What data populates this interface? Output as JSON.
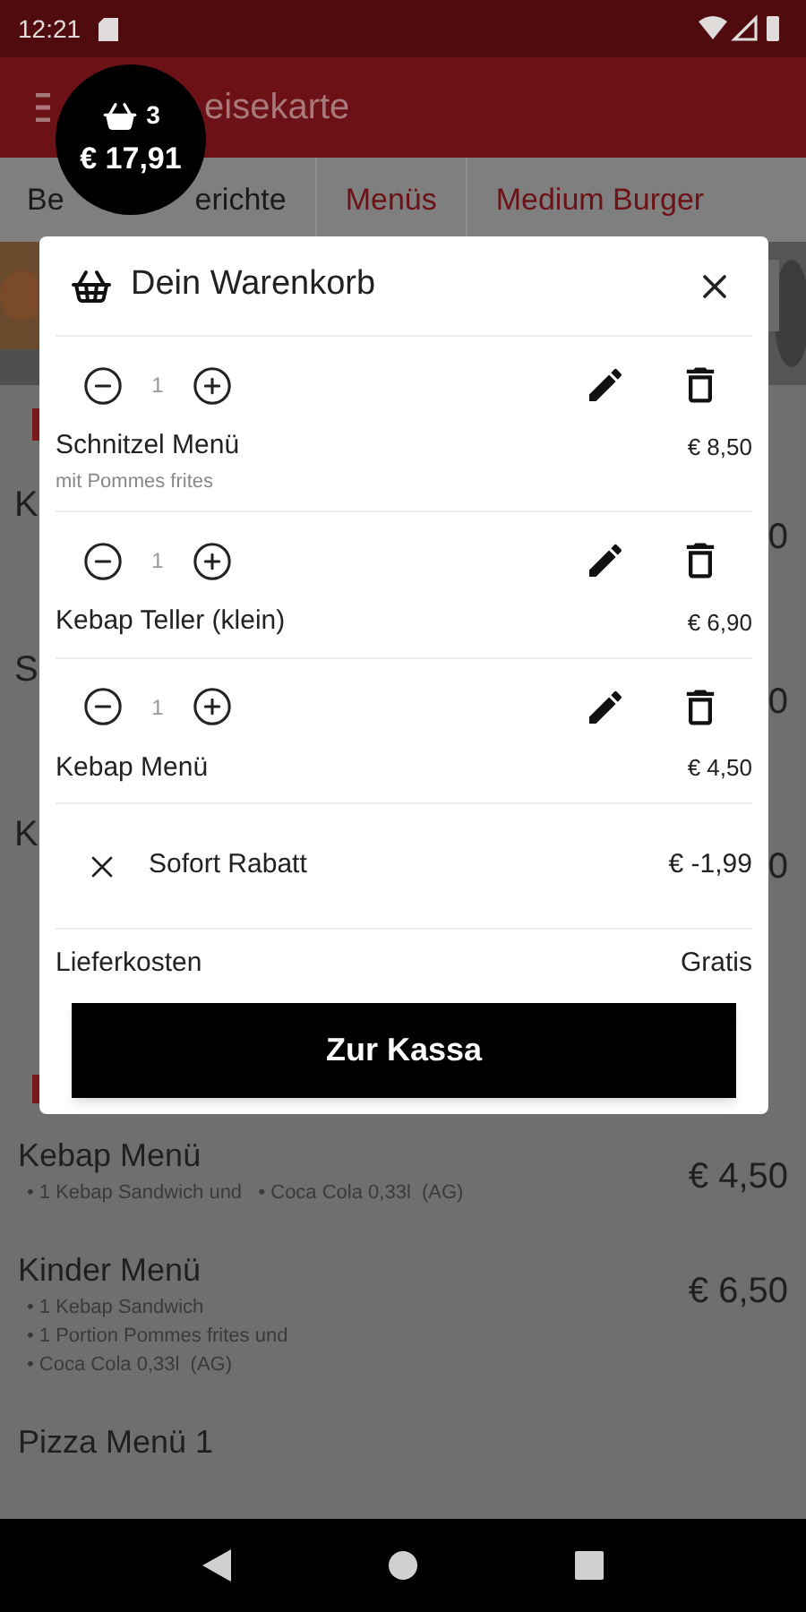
{
  "status_bar": {
    "time": "12:21"
  },
  "app_bar": {
    "title": "eisekarte"
  },
  "cart_badge": {
    "count": "3",
    "total": "€ 17,91"
  },
  "tabs": [
    {
      "parts": [
        "Be",
        "erichte"
      ],
      "selected": true
    },
    {
      "parts": [
        "Menüs"
      ],
      "selected": false
    },
    {
      "parts": [
        "Medium Burger"
      ],
      "selected": false
    }
  ],
  "background_rows": [
    {
      "title": "K",
      "price": "0"
    },
    {
      "title": "S",
      "price": "0"
    },
    {
      "title": "K",
      "price": "0"
    }
  ],
  "cart": {
    "title": "Dein Warenkorb",
    "items": [
      {
        "quantity": "1",
        "name": "Schnitzel Menü",
        "note": "mit Pommes frites",
        "price": "€ 8,50"
      },
      {
        "quantity": "1",
        "name": "Kebap Teller (klein)",
        "price": "€ 6,90"
      },
      {
        "quantity": "1",
        "name": "Kebap Menü",
        "price": "€ 4,50"
      }
    ],
    "discount": {
      "label": "Sofort Rabatt",
      "amount": "€ -1,99"
    },
    "delivery": {
      "label": "Lieferkosten",
      "value": "Gratis"
    },
    "checkout_button": "Zur Kassa"
  },
  "menu": [
    {
      "name": "Kebap Menü",
      "lines": [
        "• 1 Kebap Sandwich und   • Coca Cola 0,33l  (AG)"
      ],
      "price": "€ 4,50"
    },
    {
      "name": "Kinder Menü",
      "lines": [
        "• 1 Kebap Sandwich",
        "• 1 Portion Pommes frites und",
        "• Coca Cola 0,33l  (AG)"
      ],
      "price": "€ 6,50"
    },
    {
      "name": "Pizza Menü 1"
    }
  ]
}
